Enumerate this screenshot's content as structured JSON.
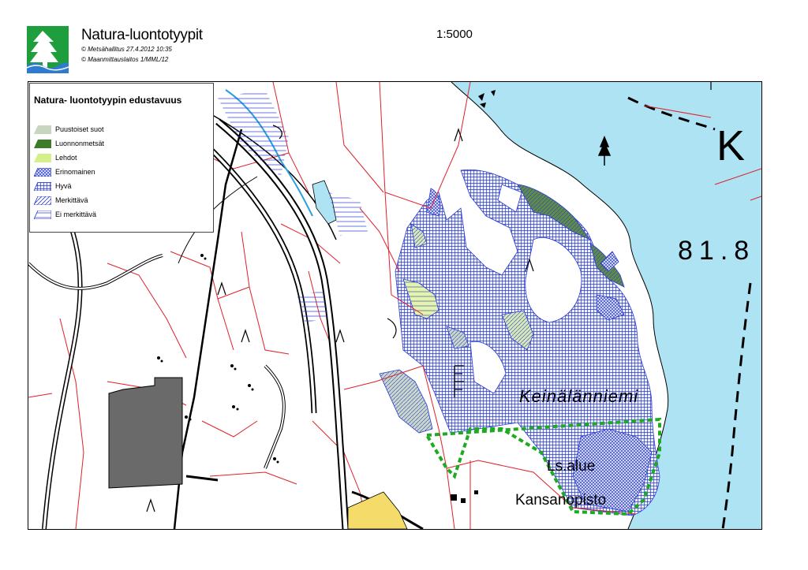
{
  "header": {
    "title": "Natura-luontotyypit",
    "copyright_1": "© Metsähallitus 27.4.2012 10:35",
    "copyright_2": "© Maanmittauslaitos 1/MML/12",
    "scale": "1:5000",
    "logo_icon": "metsahallitus-tree-icon",
    "logo_color": "#1e9e3c"
  },
  "legend": {
    "title": "Natura- luontotyypin edustavuus",
    "items": [
      {
        "label": "Puustoiset suot",
        "color": "#c8d6c0",
        "pattern": "solid"
      },
      {
        "label": "Luonnonmetsät",
        "color": "#3d7a2a",
        "pattern": "solid"
      },
      {
        "label": "Lehdot",
        "color": "#d4f08a",
        "pattern": "solid"
      },
      {
        "label": "Erinomainen",
        "color": "#2a3ad0",
        "pattern": "crosshatch"
      },
      {
        "label": "Hyvä",
        "color": "#2a3ad0",
        "pattern": "grid"
      },
      {
        "label": "Merkittävä",
        "color": "#2a3ad0",
        "pattern": "diagonal"
      },
      {
        "label": "Ei merkittävä",
        "color": "#2a3ad0",
        "pattern": "horizontal"
      }
    ]
  },
  "map": {
    "labels": {
      "place": "Keinälänniemi",
      "area": "Ls.alue",
      "building": "Kansanopisto",
      "height": "81.8",
      "lake": "K"
    },
    "colors": {
      "water": "#aee3f4",
      "property_line": "#e0202a",
      "road": "#000000",
      "protected_area": "#1eaa22",
      "building": "#6a6a6a",
      "yellow_area": "#f5dc6a",
      "stream": "#2a9fe0"
    }
  }
}
